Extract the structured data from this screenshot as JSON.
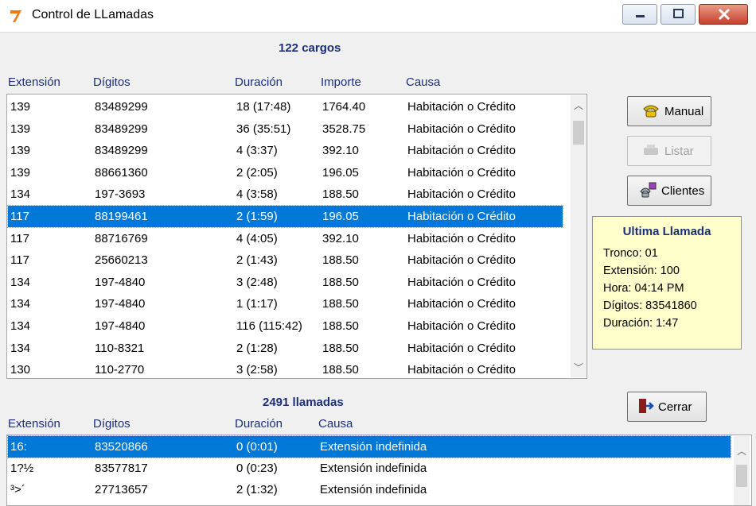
{
  "window": {
    "title": "Control de LLamadas",
    "icons": {
      "app": "app-icon",
      "min": "minimize-icon",
      "max": "maximize-icon",
      "close": "close-icon"
    }
  },
  "charges": {
    "heading": "122 cargos",
    "columns": [
      "Extensión",
      "Dígitos",
      "Duración",
      "Importe",
      "Causa"
    ],
    "rows": [
      [
        "139",
        "83489299",
        "18 (17:48)",
        "1764.40",
        "Habitación o Crédito"
      ],
      [
        "139",
        "83489299",
        "36 (35:51)",
        "3528.75",
        "Habitación o Crédito"
      ],
      [
        "139",
        "83489299",
        "4 (3:37)",
        "392.10",
        "Habitación o Crédito"
      ],
      [
        "139",
        "88661360",
        "2 (2:05)",
        "196.05",
        "Habitación o Crédito"
      ],
      [
        "134",
        "197-3693",
        "4 (3:58)",
        "188.50",
        "Habitación o Crédito"
      ],
      [
        "117",
        "88199461",
        "2 (1:59)",
        "196.05",
        "Habitación o Crédito"
      ],
      [
        "117",
        "88716769",
        "4 (4:05)",
        "392.10",
        "Habitación o Crédito"
      ],
      [
        "117",
        "25660213",
        "2 (1:43)",
        "188.50",
        "Habitación o Crédito"
      ],
      [
        "134",
        "197-4840",
        "3 (2:48)",
        "188.50",
        "Habitación o Crédito"
      ],
      [
        "134",
        "197-4840",
        "1 (1:17)",
        "188.50",
        "Habitación o Crédito"
      ],
      [
        "134",
        "197-4840",
        "116 (115:42)",
        "188.50",
        "Habitación o Crédito"
      ],
      [
        "134",
        "110-8321",
        "2 (1:28)",
        "188.50",
        "Habitación o Crédito"
      ],
      [
        "130",
        "110-2770",
        "3 (2:58)",
        "188.50",
        "Habitación o Crédito"
      ]
    ],
    "selected_index": 5
  },
  "buttons": {
    "manual": {
      "label": "Manual",
      "icon": "phone-icon"
    },
    "listar": {
      "label": "Listar",
      "icon": "printer-icon",
      "disabled": true
    },
    "clientes": {
      "label": "Clientes",
      "icon": "client-phone-icon"
    },
    "cerrar": {
      "label": "Cerrar",
      "icon": "exit-door-icon"
    }
  },
  "last_call": {
    "title": "Ultima Llamada",
    "lines": [
      "Tronco: 01",
      "Extensión: 100",
      "Hora: 04:14 PM",
      "Dígitos: 83541860",
      "Duración: 1:47"
    ]
  },
  "calls": {
    "heading": "2491 llamadas",
    "columns": [
      "Extensión",
      "Dígitos",
      "Duración",
      "Causa"
    ],
    "rows": [
      [
        "16:",
        "83520866",
        "0 (0:01)",
        "Extensión indefinida"
      ],
      [
        "1?½",
        "83577817",
        "0 (0:23)",
        "Extensión indefinida"
      ],
      [
        "³>´",
        "27713657",
        "2 (1:32)",
        "Extensión indefinida"
      ]
    ],
    "selected_index": 0
  },
  "colors": {
    "selection": "#0078d7",
    "heading_text": "#1c2e7a",
    "last_call_bg": "#ffffcc"
  }
}
